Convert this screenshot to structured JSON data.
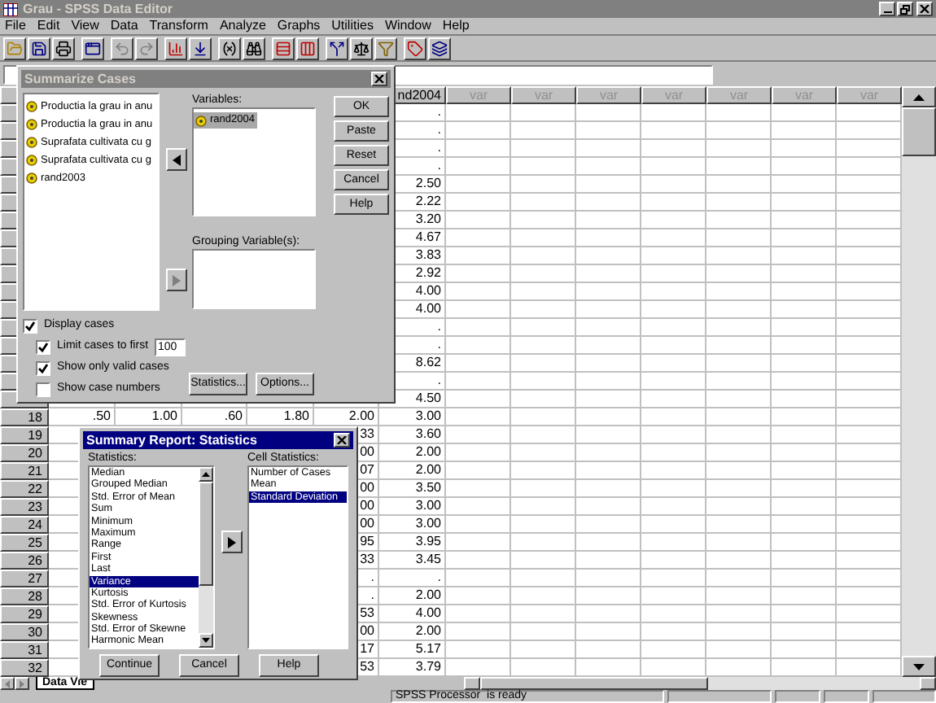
{
  "window": {
    "title": "Grau - SPSS Data Editor"
  },
  "menu": [
    "File",
    "Edit",
    "View",
    "Data",
    "Transform",
    "Analyze",
    "Graphs",
    "Utilities",
    "Window",
    "Help"
  ],
  "grid": {
    "headers": [
      "nd2004",
      "var",
      "var",
      "var",
      "var",
      "var",
      "var",
      "var"
    ],
    "rows": [
      {
        "rand2004": "."
      },
      {
        "rand2004": "."
      },
      {
        "rand2004": "."
      },
      {
        "rand2004": "."
      },
      {
        "rand2004": "2.50"
      },
      {
        "rand2004": "2.22"
      },
      {
        "rand2004": "3.20"
      },
      {
        "rand2004": "4.67"
      },
      {
        "rand2004": "3.83"
      },
      {
        "rand2004": "2.92"
      },
      {
        "rand2004": "4.00"
      },
      {
        "rand2004": "4.00"
      },
      {
        "rand2004": "."
      },
      {
        "rand2004": "."
      },
      {
        "rand2004": "8.62"
      },
      {
        "rand2004": "."
      },
      {
        "rand2004": "4.50"
      },
      {
        "number": "18",
        "values": [
          ".50",
          "1.00",
          ".60",
          "1.80",
          "2.00"
        ],
        "rand2004": "3.00"
      },
      {
        "number": "19",
        "column_5": "33",
        "rand2004": "3.60"
      },
      {
        "number": "20",
        "column_5": "00",
        "rand2004": "2.00"
      },
      {
        "number": "21",
        "column_5": "07",
        "rand2004": "2.00"
      },
      {
        "number": "22",
        "column_5": "00",
        "rand2004": "3.50"
      },
      {
        "number": "23",
        "column_5": "00",
        "rand2004": "3.00"
      },
      {
        "number": "24",
        "column_5": "00",
        "rand2004": "3.00"
      },
      {
        "number": "25",
        "column_5": "95",
        "rand2004": "3.95"
      },
      {
        "number": "26",
        "column_5": "33",
        "rand2004": "3.45"
      },
      {
        "number": "27",
        "column_5": ".",
        "rand2004": "."
      },
      {
        "number": "28",
        "column_5": ".",
        "rand2004": "2.00"
      },
      {
        "number": "29",
        "column_5": "53",
        "rand2004": "4.00"
      },
      {
        "number": "30",
        "column_5": "00",
        "rand2004": "2.00"
      },
      {
        "number": "31",
        "column_5": "17",
        "rand2004": "5.17"
      },
      {
        "number": "32",
        "column_5": "53",
        "rand2004": "3.79"
      }
    ]
  },
  "sheet_tab": "Data Vie",
  "status_bar": "SPSS Processor  is ready",
  "summarize_dialog": {
    "title": "Summarize Cases",
    "active": false,
    "source_list": [
      {
        "label": "Productia la grau in anu",
        "selected": false
      },
      {
        "label": "Productia la grau in anu",
        "selected": false
      },
      {
        "label": "Suprafata cultivata cu g",
        "selected": false
      },
      {
        "label": "Suprafata cultivata cu g",
        "selected": false
      },
      {
        "label": "rand2003",
        "selected": false
      }
    ],
    "arrow_buttons": [
      {
        "kind": "move_left",
        "disabled": false
      },
      {
        "kind": "move_right",
        "disabled": true
      }
    ],
    "variables_label": "Variables:",
    "variables": [
      {
        "label": "rand2004",
        "selected": true
      }
    ],
    "grouping_label": "Grouping Variable(s):",
    "buttons": [
      "OK",
      "Paste",
      "Reset",
      "Cancel",
      "Help"
    ],
    "options": [
      {
        "label": "Display cases",
        "checked": true,
        "children": [
          {
            "label": "Limit cases to first",
            "checked": true,
            "value": "100"
          },
          {
            "label": "Show only valid cases",
            "checked": true
          },
          {
            "label": "Show case numbers",
            "checked": false
          }
        ]
      }
    ],
    "bottom_buttons": [
      "Statistics...",
      "Options..."
    ]
  },
  "statistics_dialog": {
    "title": "Summary Report: Statistics",
    "active": true,
    "statistics_label": "Statistics:",
    "statistics": [
      {
        "label": "Median",
        "selected": false
      },
      {
        "label": "Grouped Median",
        "selected": false
      },
      {
        "label": "Std. Error of Mean",
        "selected": false
      },
      {
        "label": "Sum",
        "selected": false
      },
      {
        "label": "Minimum",
        "selected": false
      },
      {
        "label": "Maximum",
        "selected": false
      },
      {
        "label": "Range",
        "selected": false
      },
      {
        "label": "First",
        "selected": false
      },
      {
        "label": "Last",
        "selected": false
      },
      {
        "label": "Variance",
        "selected": true
      },
      {
        "label": "Kurtosis",
        "selected": false
      },
      {
        "label": "Std. Error of Kurtosis",
        "selected": false
      },
      {
        "label": "Skewness",
        "selected": false
      },
      {
        "label": "Std. Error of Skewne",
        "selected": false
      },
      {
        "label": "Harmonic Mean",
        "selected": false
      }
    ],
    "arrow_button": {
      "kind": "move_right",
      "disabled": false
    },
    "cell_statistics_label": "Cell Statistics:",
    "cell_statistics": [
      {
        "label": "Number of Cases",
        "selected": false
      },
      {
        "label": "Mean",
        "selected": false
      },
      {
        "label": "Standard Deviation",
        "selected": true
      }
    ],
    "buttons": [
      "Continue",
      "Cancel",
      "Help"
    ]
  }
}
